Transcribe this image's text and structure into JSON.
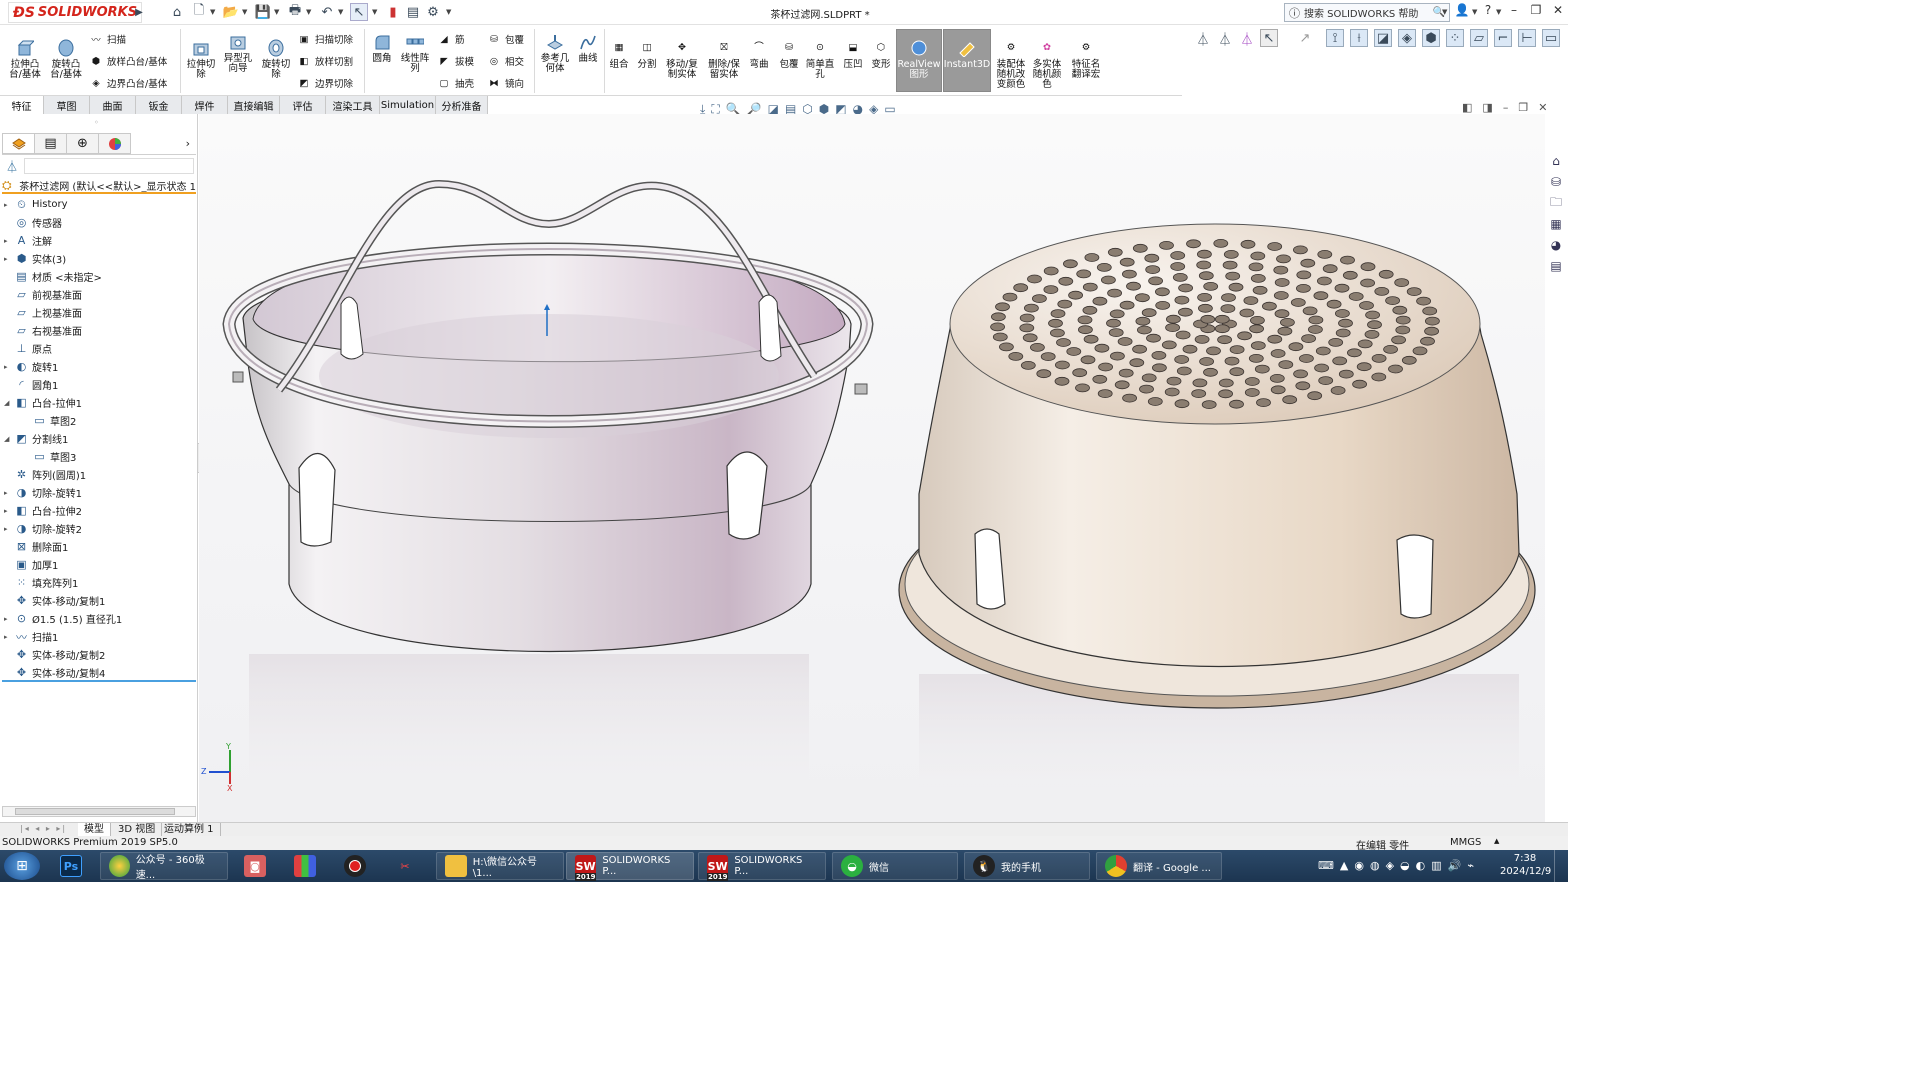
{
  "app": {
    "brand": "SOLIDWORKS",
    "doc_title": "茶杯过滤网.SLDPRT *"
  },
  "help_search": {
    "placeholder": "搜索 SOLIDWORKS 帮助"
  },
  "ribbon": {
    "extrude_boss": "拉伸凸\n台/基体",
    "revolve_boss": "旋转凸\n台/基体",
    "sweep": "扫描",
    "loft_boss": "放样凸台/基体",
    "boundary_boss": "边界凸台/基体",
    "extrude_cut": "拉伸切\n除",
    "hole_wizard": "异型孔\n向导",
    "revolve_cut": "旋转切\n除",
    "sweep_cut": "扫描切除",
    "loft_cut": "放样切割",
    "boundary_cut": "边界切除",
    "fillet": "圆角",
    "linear_pattern": "线性阵\n列",
    "rib": "筋",
    "draft": "拔模",
    "shell": "抽壳",
    "wrap": "包覆",
    "intersect": "相交",
    "mirror": "镜向",
    "ref_geometry": "参考几\n何体",
    "curves": "曲线",
    "combine": "组合",
    "split": "分割",
    "move_copy_body": "移动/复\n制实体",
    "delete_keep_body": "删除/保\n留实体",
    "flex": "弯曲",
    "wrap2": "包覆",
    "simple_hole": "简单直\n孔",
    "indent": "压凹",
    "deform": "变形",
    "realview": "RealView\n图形",
    "instant3d": "Instant3D",
    "assembly_color": "装配体\n随机改\n变颜色",
    "multibody_color": "多实体\n随机颜\n色",
    "feature_translate": "特征名\n翻译宏"
  },
  "tabs": [
    "特征",
    "草图",
    "曲面",
    "钣金",
    "焊件",
    "直接编辑",
    "评估",
    "渲染工具",
    "Simulation",
    "分析准备"
  ],
  "tree": {
    "root": "茶杯过滤网 (默认<<默认>_显示状态 1",
    "items": [
      {
        "label": "History",
        "expand": true,
        "icon": "history-icon",
        "indent": 0
      },
      {
        "label": "传感器",
        "expand": false,
        "icon": "sensor-icon",
        "indent": 0
      },
      {
        "label": "注解",
        "expand": true,
        "icon": "annotation-icon",
        "indent": 0
      },
      {
        "label": "实体(3)",
        "expand": true,
        "icon": "solid-bodies-icon",
        "indent": 0
      },
      {
        "label": "材质 <未指定>",
        "expand": false,
        "icon": "material-icon",
        "indent": 0
      },
      {
        "label": "前视基准面",
        "expand": false,
        "icon": "plane-icon",
        "indent": 0
      },
      {
        "label": "上视基准面",
        "expand": false,
        "icon": "plane-icon",
        "indent": 0
      },
      {
        "label": "右视基准面",
        "expand": false,
        "icon": "plane-icon",
        "indent": 0
      },
      {
        "label": "原点",
        "expand": false,
        "icon": "origin-icon",
        "indent": 0
      },
      {
        "label": "旋转1",
        "expand": true,
        "icon": "revolve-icon",
        "indent": 0
      },
      {
        "label": "圆角1",
        "expand": false,
        "icon": "fillet-icon",
        "indent": 0
      },
      {
        "label": "凸台-拉伸1",
        "expand": "open",
        "icon": "extrude-icon",
        "indent": 0
      },
      {
        "label": "草图2",
        "expand": false,
        "icon": "sketch-icon",
        "indent": 1
      },
      {
        "label": "分割线1",
        "expand": "open",
        "icon": "split-line-icon",
        "indent": 0
      },
      {
        "label": "草图3",
        "expand": false,
        "icon": "sketch-icon",
        "indent": 1
      },
      {
        "label": "阵列(圆周)1",
        "expand": false,
        "icon": "circular-pattern-icon",
        "indent": 0
      },
      {
        "label": "切除-旋转1",
        "expand": true,
        "icon": "cut-revolve-icon",
        "indent": 0
      },
      {
        "label": "凸台-拉伸2",
        "expand": true,
        "icon": "extrude-icon",
        "indent": 0
      },
      {
        "label": "切除-旋转2",
        "expand": true,
        "icon": "cut-revolve-icon",
        "indent": 0
      },
      {
        "label": "删除面1",
        "expand": false,
        "icon": "delete-face-icon",
        "indent": 0
      },
      {
        "label": "加厚1",
        "expand": false,
        "icon": "thicken-icon",
        "indent": 0
      },
      {
        "label": "填充阵列1",
        "expand": false,
        "icon": "fill-pattern-icon",
        "indent": 0
      },
      {
        "label": "实体-移动/复制1",
        "expand": false,
        "icon": "move-body-icon",
        "indent": 0
      },
      {
        "label": "Ø1.5 (1.5) 直径孔1",
        "expand": true,
        "icon": "hole-icon",
        "indent": 0
      },
      {
        "label": "扫描1",
        "expand": true,
        "icon": "sweep-icon",
        "indent": 0
      },
      {
        "label": "实体-移动/复制2",
        "expand": false,
        "icon": "move-body-icon",
        "indent": 0
      },
      {
        "label": "实体-移动/复制4",
        "expand": false,
        "icon": "move-body-icon",
        "indent": 0
      }
    ]
  },
  "bottom_tabs": [
    "模型",
    "3D 视图",
    "运动算例 1"
  ],
  "status": {
    "left": "SOLIDWORKS Premium 2019 SP5.0",
    "editing": "在编辑 零件",
    "units": "MMGS"
  },
  "taskbar": {
    "items": [
      "公众号 - 360极速...",
      "H:\\微信公众号\\1...",
      "SOLIDWORKS P...",
      "SOLIDWORKS P...",
      "微信",
      "我的手机",
      "翻译 - Google ..."
    ],
    "time": "7:38",
    "date": "2024/12/9",
    "ps_label": "Ps",
    "sw_badge": "2019"
  },
  "triad": {
    "x": "X",
    "y": "Y",
    "z": "Z"
  },
  "colors": {
    "brand_red": "#d4251c",
    "accent_blue": "#1f6fc5",
    "tree_highlight": "#f0a020",
    "metal_left": "#cfc8cc",
    "metal_right": "#e0d4c8"
  }
}
